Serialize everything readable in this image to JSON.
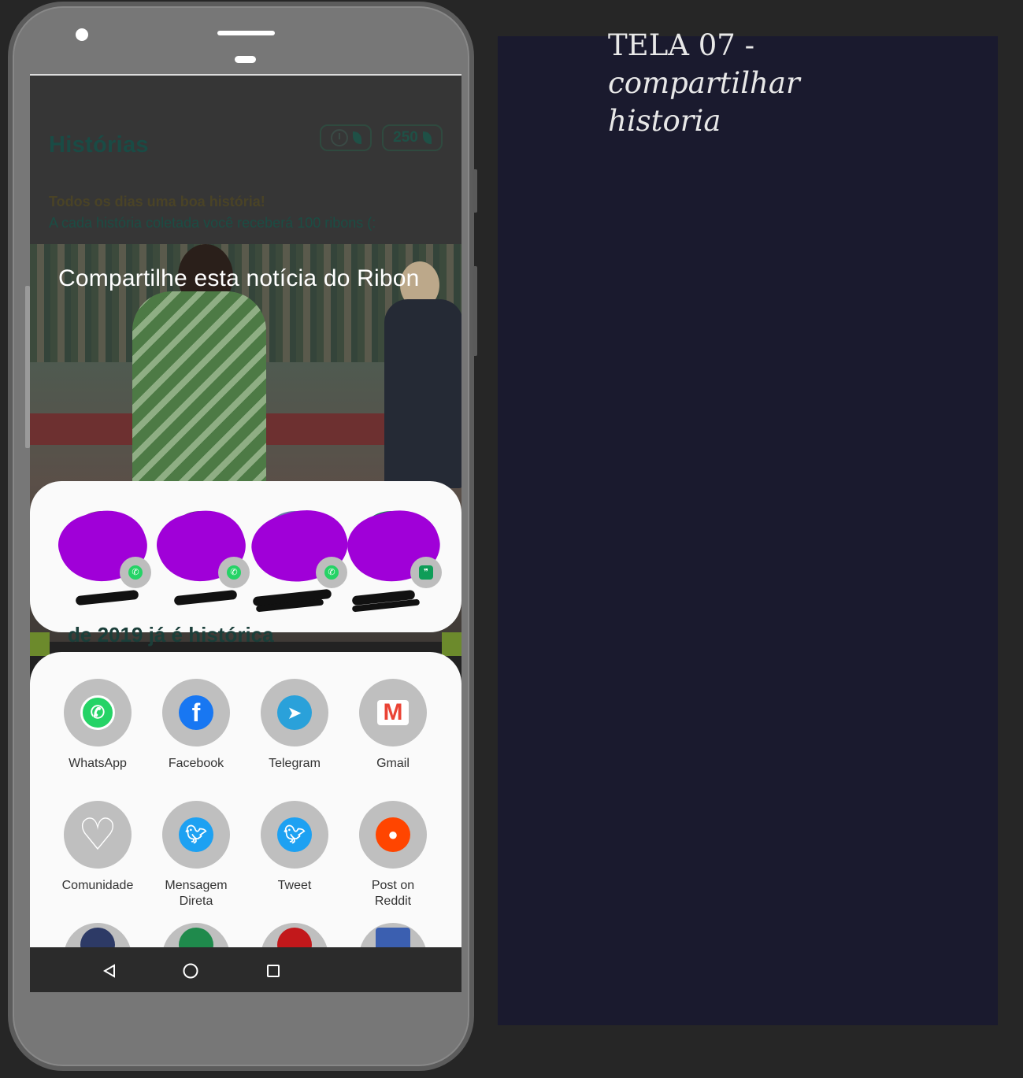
{
  "phone_screen": {
    "app_title": "Histórias",
    "coins_value": "250",
    "subtitle_line1": "Todos os dias uma boa história!",
    "subtitle_line2": "A cada história coletada você receberá 100 ribons (:",
    "share_heading": "Compartilhe esta notícia do Ribon",
    "behind_text": "de 2019 já é histórica",
    "direct_share_contacts": [
      {
        "badge": "whatsapp-icon"
      },
      {
        "badge": "whatsapp-icon"
      },
      {
        "badge": "whatsapp-icon"
      },
      {
        "badge": "hangouts-icon"
      }
    ],
    "share_apps": [
      {
        "label": "WhatsApp",
        "icon": "whatsapp-icon",
        "color": "#25D366"
      },
      {
        "label": "Facebook",
        "icon": "facebook-icon",
        "color": "#1877F2"
      },
      {
        "label": "Telegram",
        "icon": "telegram-icon",
        "color": "#2AA1DA"
      },
      {
        "label": "Gmail",
        "icon": "gmail-icon",
        "color": "#EA4335"
      },
      {
        "label": "Comunidade",
        "icon": "heart-icon",
        "color": "#FFFFFF"
      },
      {
        "label": "Mensagem Direta",
        "icon": "twitter-icon",
        "color": "#1DA1F2"
      },
      {
        "label": "Tweet",
        "icon": "twitter-icon",
        "color": "#1DA1F2"
      },
      {
        "label": "Post on Reddit",
        "icon": "reddit-icon",
        "color": "#FF4500"
      }
    ]
  },
  "annotation": {
    "title_line1": "TELA 07 -",
    "title_line2": "compartilhar",
    "title_line3": "historia"
  }
}
